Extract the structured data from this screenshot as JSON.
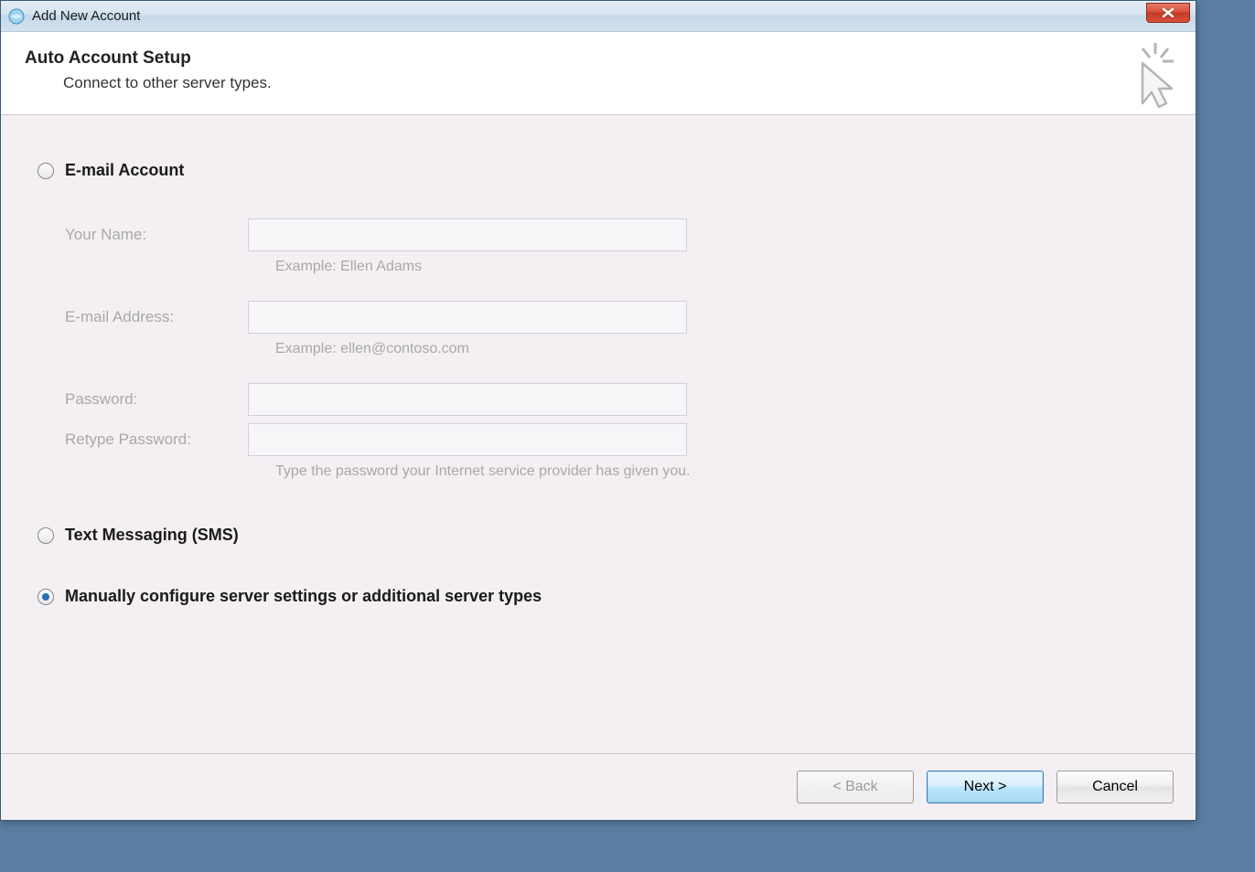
{
  "window": {
    "title": "Add New Account"
  },
  "header": {
    "title": "Auto Account Setup",
    "subtitle": "Connect to other server types."
  },
  "options": {
    "email": {
      "label": "E-mail Account",
      "selected": false
    },
    "sms": {
      "label": "Text Messaging (SMS)",
      "selected": false
    },
    "manual": {
      "label": "Manually configure server settings or additional server types",
      "selected": true
    }
  },
  "form": {
    "name_label": "Your Name:",
    "name_value": "",
    "name_hint": "Example: Ellen Adams",
    "email_label": "E-mail Address:",
    "email_value": "",
    "email_hint": "Example: ellen@contoso.com",
    "password_label": "Password:",
    "password_value": "",
    "retype_label": "Retype Password:",
    "retype_value": "",
    "password_hint": "Type the password your Internet service provider has given you."
  },
  "footer": {
    "back_label": "< Back",
    "next_label": "Next >",
    "cancel_label": "Cancel"
  }
}
